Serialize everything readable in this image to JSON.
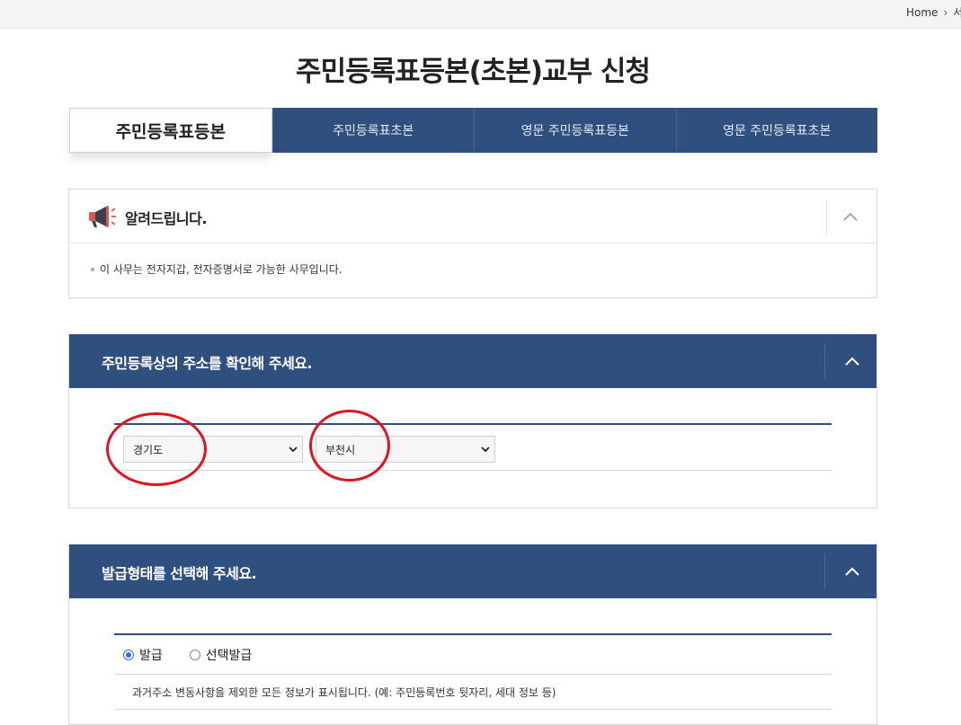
{
  "breadcrumb": {
    "home": "Home",
    "next": "서"
  },
  "page_title": "주민등록표등본(초본)교부 신청",
  "tabs": [
    {
      "label": "주민등록표등본",
      "active": true
    },
    {
      "label": "주민등록표초본",
      "active": false
    },
    {
      "label": "영문 주민등록표등본",
      "active": false
    },
    {
      "label": "영문 주민등록표초본",
      "active": false
    }
  ],
  "notice": {
    "icon": "megaphone-icon",
    "title": "알려드립니다.",
    "text": "이 사무는 전자지갑, 전자증명서로 가능한 사무입니다."
  },
  "address_section": {
    "title": "주민등록상의 주소를 확인해 주세요.",
    "province_select": "경기도",
    "city_select": "부천시"
  },
  "issue_section": {
    "title": "발급형태를 선택해 주세요.",
    "option_issue": "발급",
    "option_selective": "선택발급",
    "selected": "발급",
    "description": "과거주소 변동사항을 제외한 모든 정보가 표시됩니다. (예: 주민등록번호 뒷자리, 세대 정보 등)"
  },
  "colors": {
    "navy": "#2f4f7f",
    "highlight_circle": "#e0141e",
    "radio": "#2f6fd6"
  }
}
